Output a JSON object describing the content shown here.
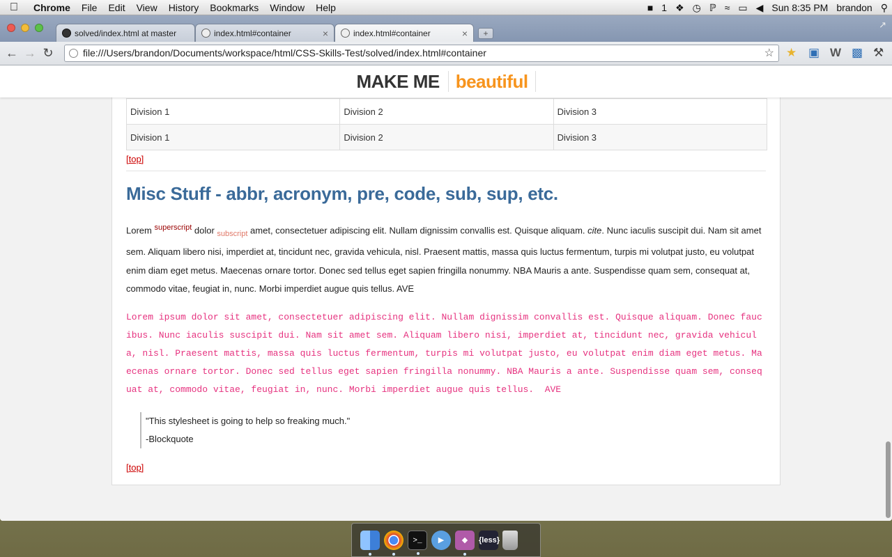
{
  "menubar": {
    "app": "Chrome",
    "items": [
      "File",
      "Edit",
      "View",
      "History",
      "Bookmarks",
      "Window",
      "Help"
    ],
    "status_number": "1",
    "clock": "Sun 8:35 PM",
    "user": "brandon"
  },
  "tabs": [
    {
      "label": "solved/index.html at master"
    },
    {
      "label": "index.html#container"
    },
    {
      "label": "index.html#container"
    }
  ],
  "address_bar": {
    "url": "file:///Users/brandon/Documents/workspace/html/CSS-Skills-Test/solved/index.html#container"
  },
  "site_header": {
    "word1": "MAKE ME",
    "word2": "beautiful"
  },
  "table": {
    "rows": [
      [
        "Division 1",
        "Division 2",
        "Division 3"
      ],
      [
        "Division 1",
        "Division 2",
        "Division 3"
      ]
    ]
  },
  "links": {
    "top1": "[top]",
    "top2": "[top]"
  },
  "misc": {
    "heading": "Misc Stuff - abbr, acronym, pre, code, sub, sup, etc.",
    "para_lorem": "Lorem ",
    "para_sup": "superscript",
    "para_dolor": " dolor ",
    "para_sub": "subscript",
    "para_mid": " amet, consectetuer adipiscing elit. Nullam dignissim convallis est. Quisque aliquam. ",
    "para_cite": "cite",
    "para_end": ". Nunc iaculis suscipit dui. Nam sit amet sem. Aliquam libero nisi, imperdiet at, tincidunt nec, gravida vehicula, nisl. Praesent mattis, massa quis luctus fermentum, turpis mi volutpat justo, eu volutpat enim diam eget metus. Maecenas ornare tortor. Donec sed tellus eget sapien fringilla nonummy. NBA Mauris a ante. Suspendisse quam sem, consequat at, commodo vitae, feugiat in, nunc. Morbi imperdiet augue quis tellus. AVE",
    "pre": "Lorem ipsum dolor sit amet, consectetuer adipiscing elit. Nullam dignissim convallis est. Quisque aliquam. Donec faucibus. Nunc iaculis suscipit dui. Nam sit amet sem. Aliquam libero nisi, imperdiet at, tincidunt nec, gravida vehicula, nisl. Praesent mattis, massa quis luctus fermentum, turpis mi volutpat justo, eu volutpat enim diam eget metus. Maecenas ornare tortor. Donec sed tellus eget sapien fringilla nonummy. NBA Mauris a ante. Suspendisse quam sem, consequat at, commodo vitae, feugiat in, nunc. Morbi imperdiet augue quis tellus.  AVE",
    "quote": "\"This stylesheet is going to help so freaking much.\"",
    "quote_cite": "-Blockquote"
  },
  "dock": {
    "less_label": "{less}"
  },
  "colors": {
    "brand_orange": "#f7941d",
    "heading_blue": "#3a6a99",
    "pre_pink": "#e6327f",
    "link_red": "#cc0000"
  }
}
